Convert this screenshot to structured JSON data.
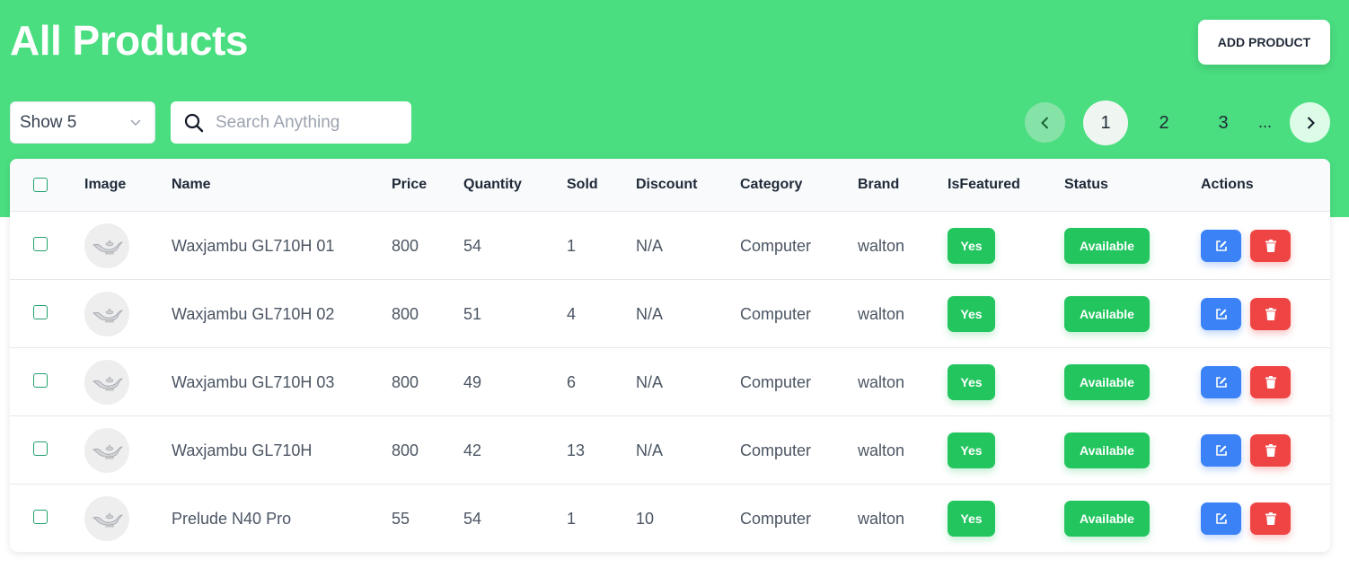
{
  "header": {
    "title": "All Products",
    "add_button_label": "ADD PRODUCT",
    "accent_color": "#4ade80"
  },
  "controls": {
    "show_select_value": "Show 5",
    "search_placeholder": "Search Anything"
  },
  "pagination": {
    "pages": [
      "1",
      "2",
      "3"
    ],
    "current": "1",
    "ellipsis": "..."
  },
  "table": {
    "columns": [
      "Image",
      "Name",
      "Price",
      "Quantity",
      "Sold",
      "Discount",
      "Category",
      "Brand",
      "IsFeatured",
      "Status",
      "Actions"
    ],
    "rows": [
      {
        "name": "Waxjambu GL710H 01",
        "price": "800",
        "quantity": "54",
        "sold": "1",
        "discount": "N/A",
        "category": "Computer",
        "brand": "walton",
        "featured": "Yes",
        "status": "Available"
      },
      {
        "name": "Waxjambu GL710H 02",
        "price": "800",
        "quantity": "51",
        "sold": "4",
        "discount": "N/A",
        "category": "Computer",
        "brand": "walton",
        "featured": "Yes",
        "status": "Available"
      },
      {
        "name": "Waxjambu GL710H 03",
        "price": "800",
        "quantity": "49",
        "sold": "6",
        "discount": "N/A",
        "category": "Computer",
        "brand": "walton",
        "featured": "Yes",
        "status": "Available"
      },
      {
        "name": "Waxjambu GL710H",
        "price": "800",
        "quantity": "42",
        "sold": "13",
        "discount": "N/A",
        "category": "Computer",
        "brand": "walton",
        "featured": "Yes",
        "status": "Available"
      },
      {
        "name": "Prelude N40 Pro",
        "price": "55",
        "quantity": "54",
        "sold": "1",
        "discount": "10",
        "category": "Computer",
        "brand": "walton",
        "featured": "Yes",
        "status": "Available"
      }
    ]
  },
  "icons": {
    "thumbnail": "genie-lamp-icon",
    "edit": "edit-icon",
    "delete": "trash-icon",
    "search": "search-icon",
    "prev": "chevron-left-icon",
    "next": "chevron-right-icon",
    "select": "chevron-down-icon"
  },
  "colors": {
    "badge_green": "#22c55e",
    "edit_blue": "#3b82f6",
    "delete_red": "#ef4444"
  }
}
